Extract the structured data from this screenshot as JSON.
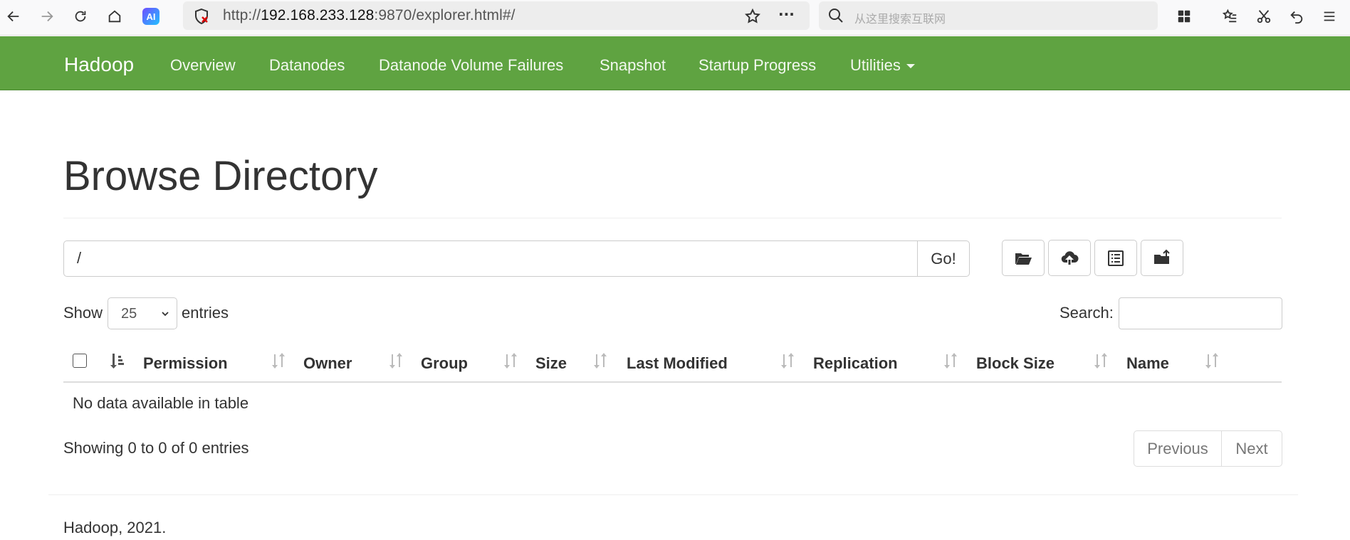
{
  "browser": {
    "url_prefix": "http://",
    "url_host": "192.168.233.128",
    "url_rest": ":9870/explorer.html#/",
    "ai_badge": "AI",
    "search_placeholder": "从这里搜索互联网",
    "more_label": "···"
  },
  "navbar": {
    "brand": "Hadoop",
    "items": [
      "Overview",
      "Datanodes",
      "Datanode Volume Failures",
      "Snapshot",
      "Startup Progress",
      "Utilities"
    ],
    "color": "#5fa341"
  },
  "page": {
    "title": "Browse Directory",
    "path_value": "/",
    "go_label": "Go!",
    "show_label": "Show",
    "entries_value": "25",
    "entries_label": "entries",
    "search_label": "Search:"
  },
  "toolbar_icons": [
    "folder-open-icon",
    "cloud-upload-icon",
    "list-alt-icon",
    "folder-plus-icon"
  ],
  "table": {
    "columns": [
      "Permission",
      "Owner",
      "Group",
      "Size",
      "Last Modified",
      "Replication",
      "Block Size",
      "Name"
    ],
    "empty_message": "No data available in table",
    "info": "Showing 0 to 0 of 0 entries",
    "prev_label": "Previous",
    "next_label": "Next"
  },
  "footer": {
    "text": "Hadoop, 2021."
  }
}
